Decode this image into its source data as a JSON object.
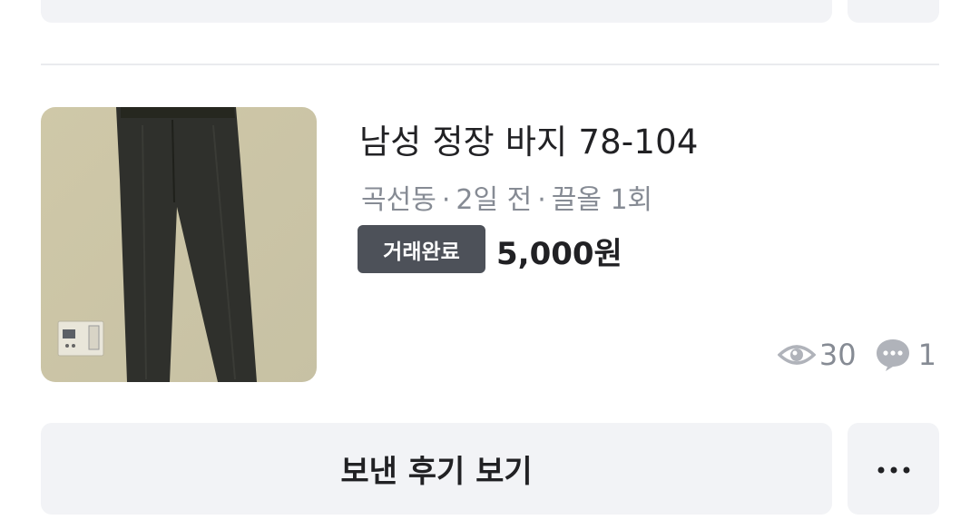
{
  "item": {
    "title": "남성 정장 바지 78-104",
    "location": "곡선동",
    "time": "2일 전",
    "bump": "끌올 1회",
    "meta_separator": "·",
    "status_badge": "거래완료",
    "price": "5,000원",
    "views": "30",
    "chats": "1"
  },
  "actions": {
    "review_label": "보낸 후기 보기",
    "more_label": "···"
  },
  "icons": {
    "views": "eye-icon",
    "chats": "chat-bubble-icon",
    "more": "more-dots-icon"
  },
  "colors": {
    "badge_bg": "#4d5159",
    "muted_text": "#868b94",
    "button_bg": "#f2f3f6"
  }
}
